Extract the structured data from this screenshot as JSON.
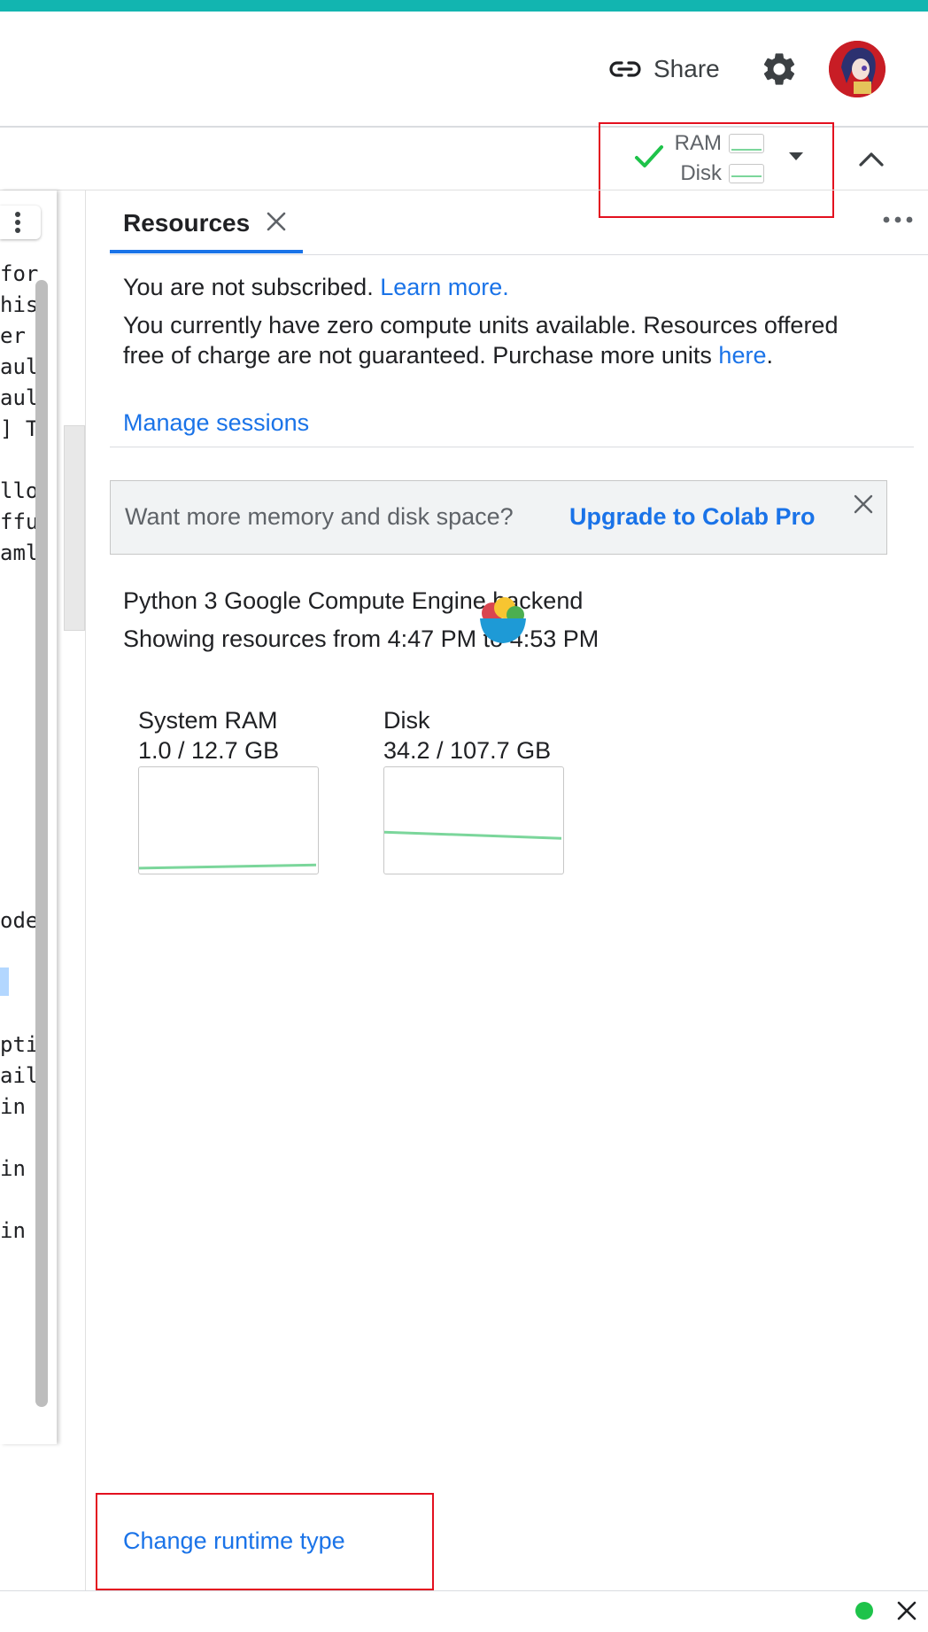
{
  "header": {
    "share_label": "Share"
  },
  "resource_indicator": {
    "ram_label": "RAM",
    "disk_label": "Disk",
    "status": "connected",
    "ram_fraction": 0.08,
    "disk_fraction": 0.32
  },
  "left_code_fragments": [
    "for",
    "his",
    "er ",
    "aul",
    "aul",
    "] T",
    "llo",
    "ffu",
    "aml",
    "ode",
    "pti",
    "ail",
    "in ",
    "in ",
    "in "
  ],
  "panel": {
    "tab_label": "Resources",
    "subscription_text": "You are not subscribed.",
    "learn_more": "Learn more.",
    "compute_text": "You currently have zero compute units available. Resources offered free of charge are not guaranteed. Purchase more units",
    "here_link": "here",
    "period": ".",
    "manage_sessions": "Manage sessions",
    "banner_text": "Want more memory and disk space?",
    "upgrade_link": "Upgrade to Colab Pro",
    "backend_text": "Python 3 Google Compute Engine backend",
    "showing_text": "Showing resources from 4:47 PM to 4:53 PM",
    "change_runtime": "Change runtime type"
  },
  "chart_data": [
    {
      "type": "line",
      "title": "System RAM",
      "value_text": "1.0 / 12.7 GB",
      "x": [
        0,
        1
      ],
      "y": [
        0.035,
        0.065
      ],
      "ylim": [
        0,
        1
      ],
      "color": "#7bd69b",
      "grid": false
    },
    {
      "type": "line",
      "title": "Disk",
      "value_text": "34.2 / 107.7 GB",
      "x": [
        0,
        1
      ],
      "y": [
        0.38,
        0.32
      ],
      "ylim": [
        0,
        1
      ],
      "color": "#7bd69b",
      "grid": false
    }
  ],
  "colors": {
    "accent_bar": "#12b5b0",
    "link": "#1a73e8",
    "annotation": "#e3101f",
    "ok_green": "#1ec34a"
  }
}
